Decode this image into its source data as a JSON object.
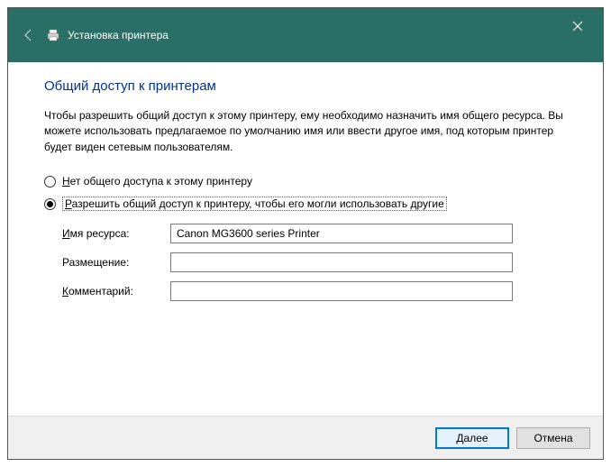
{
  "titlebar": {
    "title": "Установка принтера"
  },
  "heading": "Общий доступ к принтерам",
  "description": "Чтобы разрешить общий доступ к этому принтеру, ему необходимо назначить имя общего ресурса. Вы можете использовать предлагаемое по умолчанию имя или ввести другое имя, под которым принтер будет виден сетевым пользователям.",
  "radios": {
    "no_share": "ет общего доступа к этому принтеру",
    "no_share_u": "Н",
    "share": "азрешить общий доступ к принтеру, чтобы его могли использовать другие",
    "share_u": "Р"
  },
  "fields": {
    "name_label_u": "И",
    "name_label": "мя ресурса:",
    "name_value": "Canon MG3600 series Printer",
    "location_label": "Размещение:",
    "location_value": "",
    "comment_label_u": "К",
    "comment_label": "омментарий:",
    "comment_value": ""
  },
  "footer": {
    "next_u": "Д",
    "next": "алее",
    "cancel": "Отмена"
  }
}
